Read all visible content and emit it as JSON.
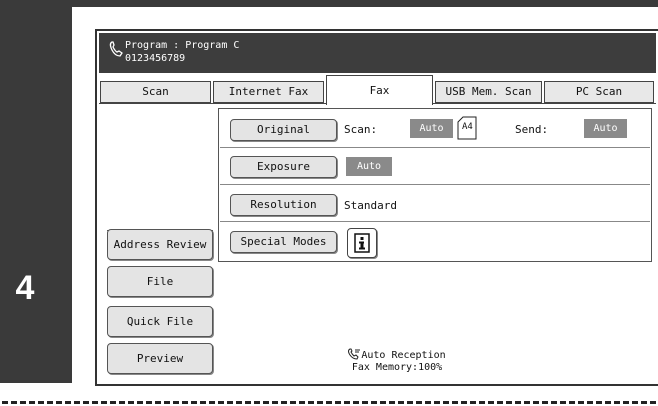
{
  "step_number": "4",
  "header": {
    "program_title": "Program : Program C",
    "destination_number": "0123456789",
    "icon": "phone-icon"
  },
  "tabs": [
    {
      "label": "Scan",
      "active": false
    },
    {
      "label": "Internet Fax",
      "active": false
    },
    {
      "label": "Fax",
      "active": true
    },
    {
      "label": "USB Mem. Scan",
      "active": false
    },
    {
      "label": "PC Scan",
      "active": false
    }
  ],
  "settings": {
    "original": {
      "button": "Original",
      "scan_label": "Scan:",
      "scan_value": "Auto",
      "paper_size": "A4",
      "send_label": "Send:",
      "send_value": "Auto"
    },
    "exposure": {
      "button": "Exposure",
      "value": "Auto"
    },
    "resolution": {
      "button": "Resolution",
      "value": "Standard"
    },
    "special_modes": {
      "button": "Special Modes",
      "info_icon": "info-icon"
    }
  },
  "left_buttons": {
    "address_review": "Address Review",
    "file": "File",
    "quick_file": "Quick File",
    "preview": "Preview"
  },
  "status": {
    "reception": "Auto Reception",
    "reception_icon": "auto-reception-icon",
    "memory": "Fax Memory:100%"
  },
  "colors": {
    "header_bg": "#3d3d3d",
    "badge_bg": "#8a8a8a",
    "button_bg": "#e4e4e4"
  }
}
